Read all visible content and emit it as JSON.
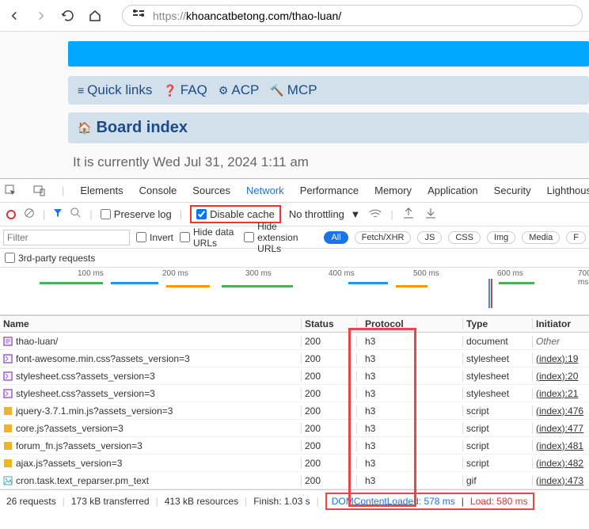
{
  "url": {
    "proto": "https://",
    "host": "khoancatbetong.com",
    "path": "/thao-luan/"
  },
  "page": {
    "quick_links": "Quick links",
    "faq": "FAQ",
    "acp": "ACP",
    "mcp": "MCP",
    "board_index": "Board index",
    "it_is": "It is currently Wed Jul 31, 2024 1:11 am"
  },
  "devtools": {
    "tabs": [
      "Elements",
      "Console",
      "Sources",
      "Network",
      "Performance",
      "Memory",
      "Application",
      "Security",
      "Lighthouse"
    ],
    "active_tab": "Network",
    "preserve_log": "Preserve log",
    "disable_cache": "Disable cache",
    "throttling": "No throttling",
    "invert": "Invert",
    "hide_data_urls": "Hide data URLs",
    "hide_ext_urls": "Hide extension URLs",
    "filter_placeholder": "Filter",
    "pills": [
      "All",
      "Fetch/XHR",
      "JS",
      "CSS",
      "Img",
      "Media",
      "F"
    ],
    "third_party": "3rd-party requests",
    "timeline_ticks": [
      "100 ms",
      "200 ms",
      "300 ms",
      "400 ms",
      "500 ms",
      "600 ms",
      "700 ms"
    ]
  },
  "columns": {
    "name": "Name",
    "status": "Status",
    "protocol": "Protocol",
    "type": "Type",
    "initiator": "Initiator"
  },
  "rows": [
    {
      "name": "thao-luan/",
      "status": "200",
      "protocol": "h3",
      "type": "document",
      "initiator": "Other",
      "initiator_plain": true,
      "icon": "doc"
    },
    {
      "name": "font-awesome.min.css?assets_version=3",
      "status": "200",
      "protocol": "h3",
      "type": "stylesheet",
      "initiator": "(index):19",
      "icon": "css"
    },
    {
      "name": "stylesheet.css?assets_version=3",
      "status": "200",
      "protocol": "h3",
      "type": "stylesheet",
      "initiator": "(index):20",
      "icon": "css"
    },
    {
      "name": "stylesheet.css?assets_version=3",
      "status": "200",
      "protocol": "h3",
      "type": "stylesheet",
      "initiator": "(index):21",
      "icon": "css"
    },
    {
      "name": "jquery-3.7.1.min.js?assets_version=3",
      "status": "200",
      "protocol": "h3",
      "type": "script",
      "initiator": "(index):476",
      "icon": "js"
    },
    {
      "name": "core.js?assets_version=3",
      "status": "200",
      "protocol": "h3",
      "type": "script",
      "initiator": "(index):477",
      "icon": "js"
    },
    {
      "name": "forum_fn.js?assets_version=3",
      "status": "200",
      "protocol": "h3",
      "type": "script",
      "initiator": "(index):481",
      "icon": "js"
    },
    {
      "name": "ajax.js?assets_version=3",
      "status": "200",
      "protocol": "h3",
      "type": "script",
      "initiator": "(index):482",
      "icon": "js"
    },
    {
      "name": "cron.task.text_reparser.pm_text",
      "status": "200",
      "protocol": "h3",
      "type": "gif",
      "initiator": "(index):473",
      "icon": "img"
    }
  ],
  "status": {
    "requests": "26 requests",
    "transferred": "173 kB transferred",
    "resources": "413 kB resources",
    "finish": "Finish: 1.03 s",
    "domloaded": "DOMContentLoaded: 578 ms",
    "load": "Load: 580 ms"
  }
}
